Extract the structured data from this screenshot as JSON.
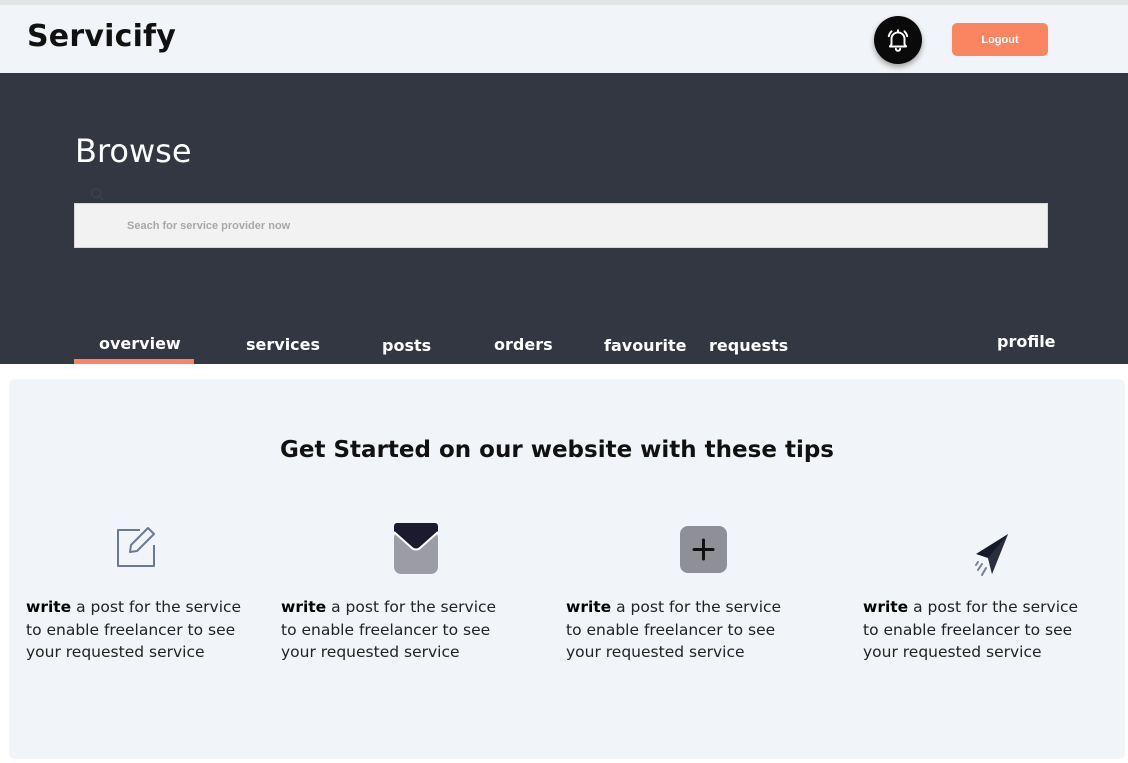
{
  "header": {
    "logo": "Servicify",
    "bell_icon": "bell-ring-icon",
    "logout_label": "Logout",
    "accent_color": "#fa8560"
  },
  "hero": {
    "title": "Browse",
    "search": {
      "placeholder": "Seach for service provider now",
      "value": ""
    }
  },
  "tabs": [
    {
      "label": "overview",
      "active": true
    },
    {
      "label": "services"
    },
    {
      "label": "posts"
    },
    {
      "label": "orders"
    },
    {
      "label": "favourite"
    },
    {
      "label": "requests"
    },
    {
      "label": "profile"
    }
  ],
  "tips": {
    "title": "Get Started on our website with these tips",
    "items": [
      {
        "icon": "edit-icon",
        "bold": "write",
        "text_line1": " a post for the service",
        "text_line2": "to enable freelancer to see",
        "text_line3": "your requested service"
      },
      {
        "icon": "inbox-icon",
        "bold": "write",
        "text_line1": " a post for the service",
        "text_line2": "to enable freelancer to see",
        "text_line3": "your requested service"
      },
      {
        "icon": "plus-square-icon",
        "bold": "write",
        "text_line1": " a post for the service",
        "text_line2": "to enable freelancer to see",
        "text_line3": "your requested service"
      },
      {
        "icon": "send-icon",
        "bold": "write",
        "text_line1": " a post for the service",
        "text_line2": "to enable freelancer to see",
        "text_line3": "your requested service"
      }
    ]
  }
}
